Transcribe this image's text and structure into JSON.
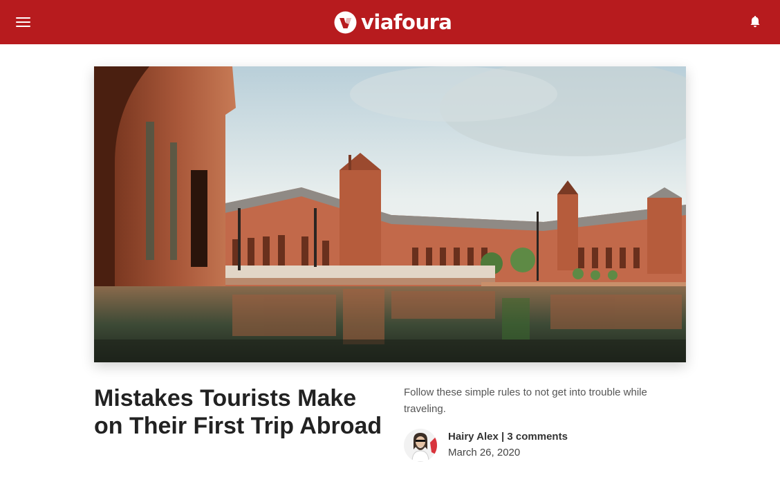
{
  "header": {
    "logo_text": "viafoura",
    "brand_color": "#b71b1e",
    "menu_icon": "hamburger-menu-icon",
    "notification_icon": "bell-icon"
  },
  "article": {
    "hero_image_alt": "Plaza de España, Seville",
    "title": "Mistakes Tourists Make on Their First Trip Abroad",
    "summary": "Follow these simple rules to not get into trouble while traveling.",
    "author": "Hairy Alex",
    "separator": "|",
    "comments": "3 comments",
    "date": "March 26, 2020"
  }
}
